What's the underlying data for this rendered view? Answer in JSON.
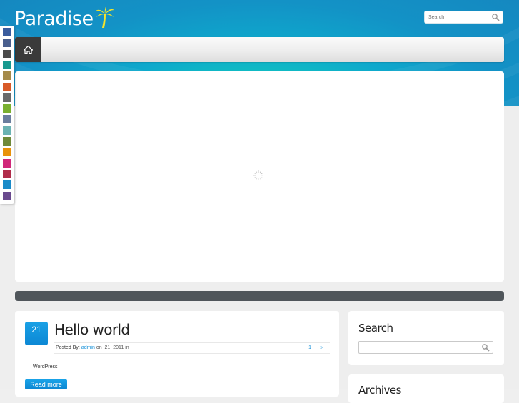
{
  "site": {
    "title": "Paradise",
    "logo_icon": "palm-tree-icon"
  },
  "header_search": {
    "placeholder": "Search",
    "icon": "magnifier-icon"
  },
  "nav": {
    "home_icon": "home-icon"
  },
  "color_switcher": {
    "swatches": [
      "#3a5c9e",
      "#4a5f8e",
      "#4a4a4a",
      "#17998f",
      "#a58a4a",
      "#d85a28",
      "#6a6a6a",
      "#7ab030",
      "#6a7e9e",
      "#6bb3b3",
      "#6f8a3a",
      "#e8920a",
      "#d0287a",
      "#b02c4a",
      "#1a8ac8",
      "#6a4a8e"
    ]
  },
  "slider": {
    "loading_icon": "spinner-icon"
  },
  "post": {
    "day": "21",
    "title": "Hello world",
    "posted_by_label": "Posted By:",
    "author": "admin",
    "on_label": "on",
    "date": "21, 2011",
    "in_label": "in",
    "comment_count": "1",
    "comment_arrow": "»",
    "excerpt": "WordPress",
    "read_more": "Read more"
  },
  "sidebar": {
    "search_widget_title": "Search",
    "archives_widget_title": "Archives"
  },
  "colors": {
    "accent": "#1590d8",
    "header_teal": "#10c2c0",
    "dark_bar": "#50565b"
  }
}
